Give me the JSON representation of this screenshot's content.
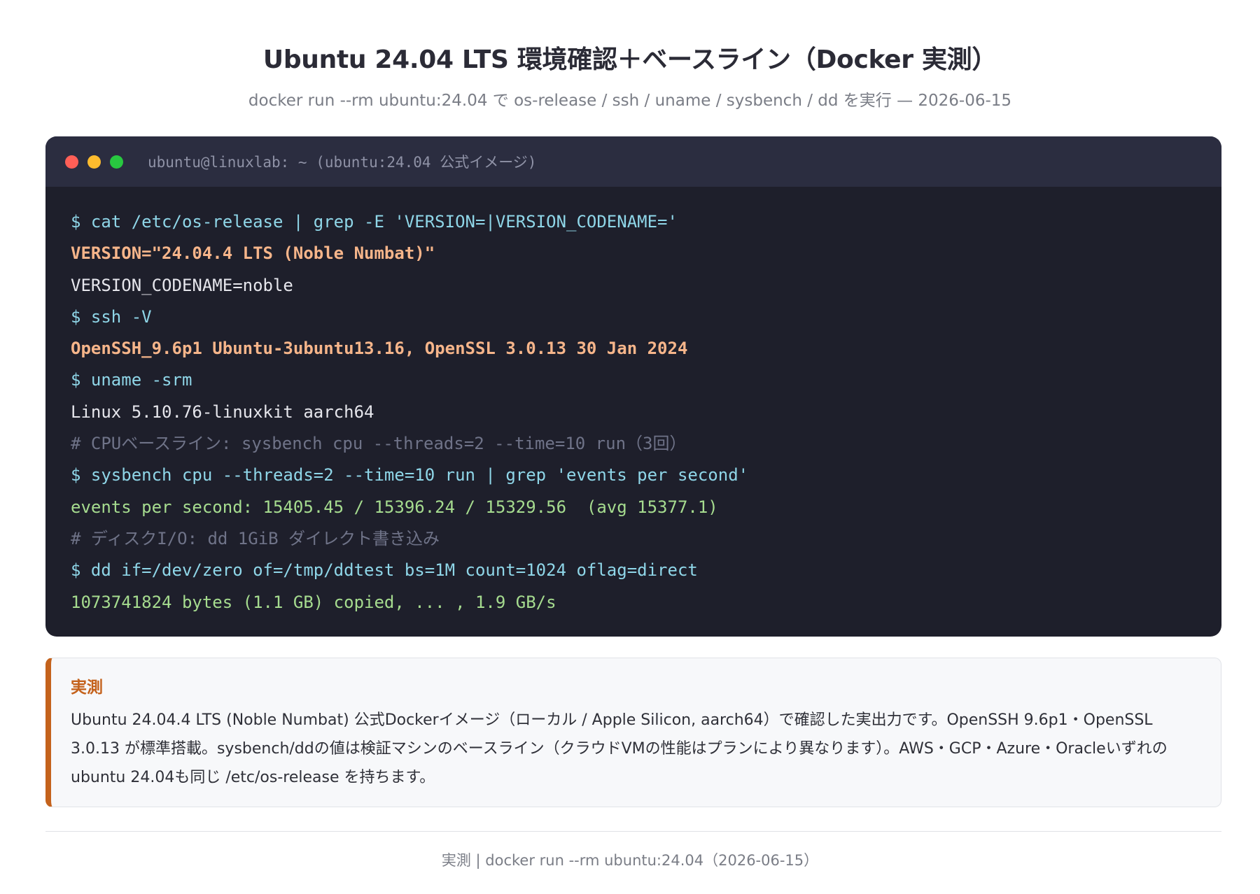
{
  "header": {
    "title": "Ubuntu 24.04 LTS 環境確認＋ベースライン（Docker 実測）",
    "subtitle": "docker run --rm ubuntu:24.04 で os-release / ssh / uname / sysbench / dd を実行 — 2026-06-15"
  },
  "terminal": {
    "title": "ubuntu@linuxlab: ~ (ubuntu:24.04 公式イメージ)",
    "dot_colors": [
      "#ff5f57",
      "#febc2e",
      "#28c840"
    ],
    "lines": [
      {
        "kind": "cmd",
        "text": "$ cat /etc/os-release | grep -E 'VERSION=|VERSION_CODENAME='"
      },
      {
        "kind": "hl",
        "text": "VERSION=\"24.04.4 LTS (Noble Numbat)\""
      },
      {
        "kind": "out",
        "text": "VERSION_CODENAME=noble"
      },
      {
        "kind": "cmd",
        "text": "$ ssh -V"
      },
      {
        "kind": "hl",
        "text": "OpenSSH_9.6p1 Ubuntu-3ubuntu13.16, OpenSSL 3.0.13 30 Jan 2024"
      },
      {
        "kind": "cmd",
        "text": "$ uname -srm"
      },
      {
        "kind": "out",
        "text": "Linux 5.10.76-linuxkit aarch64"
      },
      {
        "kind": "comment",
        "text": "# CPUベースライン: sysbench cpu --threads=2 --time=10 run（3回）"
      },
      {
        "kind": "cmd",
        "text": "$ sysbench cpu --threads=2 --time=10 run | grep 'events per second'"
      },
      {
        "kind": "ok",
        "text": "events per second: 15405.45 / 15396.24 / 15329.56  (avg 15377.1)"
      },
      {
        "kind": "comment",
        "text": "# ディスクI/O: dd 1GiB ダイレクト書き込み"
      },
      {
        "kind": "cmd",
        "text": "$ dd if=/dev/zero of=/tmp/ddtest bs=1M count=1024 oflag=direct"
      },
      {
        "kind": "ok",
        "text": "1073741824 bytes (1.1 GB) copied, ... , 1.9 GB/s"
      }
    ]
  },
  "note": {
    "title": "実測",
    "text": "Ubuntu 24.04.4 LTS (Noble Numbat) 公式Dockerイメージ（ローカル / Apple Silicon, aarch64）で確認した実出力です。OpenSSH 9.6p1・OpenSSL 3.0.13 が標準搭載。sysbench/ddの値は検証マシンのベースライン（クラウドVMの性能はプランにより異なります）。AWS・GCP・Azure・Oracleいずれのubuntu 24.04も同じ /etc/os-release を持ちます。"
  },
  "footer": {
    "text": "実測 | docker run --rm ubuntu:24.04（2026-06-15）"
  },
  "colors": {
    "accent": "#c4621c",
    "terminal_bg": "#1e1f2b",
    "terminal_bar": "#2b2d40"
  }
}
